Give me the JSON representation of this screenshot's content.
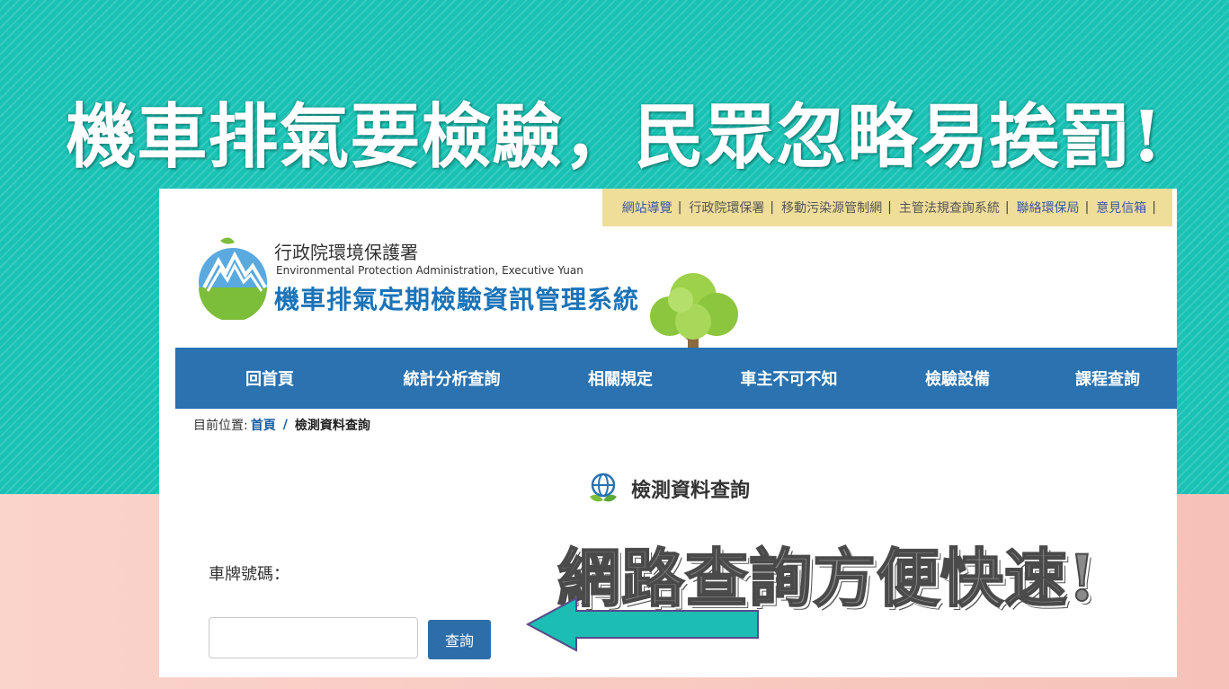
{
  "headline": "機車排氣要檢驗，民眾忽略易挨罰!",
  "colors": {
    "teal_background": "#19c2b5",
    "pink_background": "#f7c9bf",
    "nav_blue": "#2a72b0",
    "toplinks_background": "#efdd9a",
    "button_blue": "#2d6ea8",
    "arrow_teal": "#1cbdb3"
  },
  "toplinks": [
    {
      "label": "網站導覽",
      "style": "blue"
    },
    {
      "label": "行政院環保署",
      "style": "gray"
    },
    {
      "label": "移動污染源管制網",
      "style": "gray"
    },
    {
      "label": "主管法規查詢系統",
      "style": "gray"
    },
    {
      "label": "聯絡環保局",
      "style": "blue"
    },
    {
      "label": "意見信箱",
      "style": "blue"
    }
  ],
  "toplinks_separator": "|",
  "header": {
    "agency_zh": "行政院環境保護署",
    "agency_en": "Environmental Protection Administration, Executive Yuan",
    "system_title": "機車排氣定期檢驗資訊管理系統",
    "logo_icon": "epa-logo-icon",
    "decoration_icon": "tree-icon"
  },
  "nav": [
    {
      "label": "回首頁"
    },
    {
      "label": "統計分析查詢"
    },
    {
      "label": "相關規定"
    },
    {
      "label": "車主不可不知"
    },
    {
      "label": "檢驗設備"
    },
    {
      "label": "課程查詢"
    }
  ],
  "breadcrumb": {
    "prefix": "目前位置:",
    "home": "首頁",
    "separator": "/",
    "current": "檢測資料查詢"
  },
  "section": {
    "title": "檢測資料查詢",
    "icon": "globe-leaf-icon"
  },
  "form": {
    "plate_label": "車牌號碼：",
    "plate_value": "",
    "plate_placeholder": "",
    "submit_label": "查詢"
  },
  "callout": "網路查詢方便快速!",
  "arrow_icon": "arrow-left-icon"
}
